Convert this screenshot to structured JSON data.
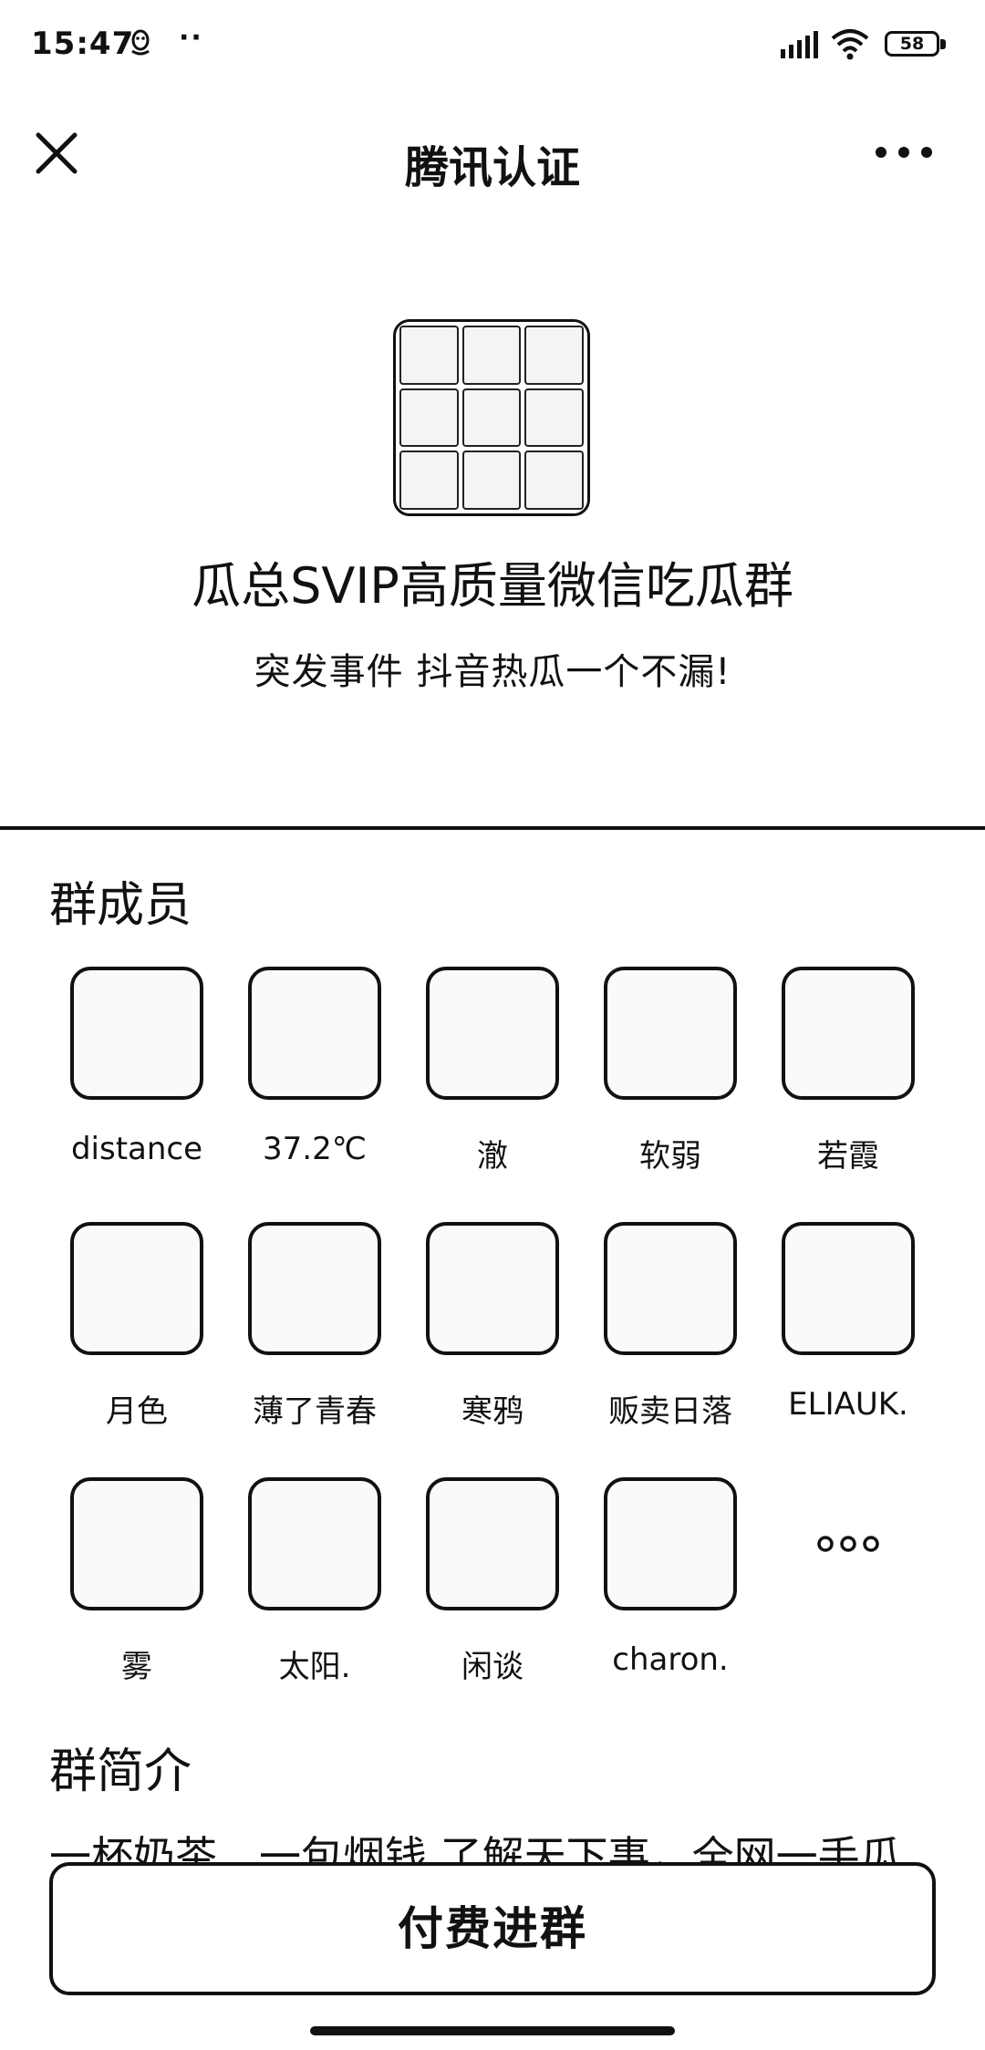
{
  "status_bar": {
    "time": "15:47",
    "dots": "··",
    "battery": "58"
  },
  "nav": {
    "title": "腾讯认证"
  },
  "group": {
    "name": "瓜总SVIP高质量微信吃瓜群",
    "tagline": "突发事件 抖音热瓜一个不漏!"
  },
  "members_section": {
    "title": "群成员",
    "members": [
      {
        "name": "distance"
      },
      {
        "name": "37.2℃"
      },
      {
        "name": "澈"
      },
      {
        "name": "软弱"
      },
      {
        "name": "若霞"
      },
      {
        "name": "月色"
      },
      {
        "name": "薄了青春"
      },
      {
        "name": "寒鸦"
      },
      {
        "name": "贩卖日落"
      },
      {
        "name": "ELIAUK."
      },
      {
        "name": "雾"
      },
      {
        "name": "太阳."
      },
      {
        "name": "闲谈"
      },
      {
        "name": "charon."
      }
    ]
  },
  "intro_section": {
    "title": "群简介",
    "text": "一杯奶茶、一包烟钱 了解天下事，全网一手瓜"
  },
  "pay_button": {
    "label": "付费进群"
  }
}
